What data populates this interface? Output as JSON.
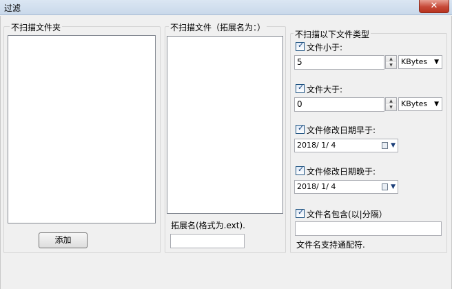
{
  "window": {
    "title": "过滤",
    "close_glyph": "✕"
  },
  "folders_panel": {
    "title": "不扫描文件夹",
    "add_button": "添加"
  },
  "files_panel": {
    "title": "不扫描文件（拓展名为：）",
    "ext_label": "拓展名(格式为.ext).",
    "ext_value": ""
  },
  "types_panel": {
    "title": "不扫描以下文件类型",
    "size_less": {
      "label": "文件小于:",
      "checked": true,
      "value": "5",
      "unit": "KBytes"
    },
    "size_greater": {
      "label": "文件大于:",
      "checked": true,
      "value": "0",
      "unit": "KBytes"
    },
    "modified_before": {
      "label": "文件修改日期早于:",
      "checked": true,
      "date": "2018/  1/  4"
    },
    "modified_after": {
      "label": "文件修改日期晚于:",
      "checked": true,
      "date": "2018/  1/  4"
    },
    "name_contains": {
      "label": "文件名包含(以|分隔）",
      "checked": true,
      "value": ""
    },
    "wildcard_note": "文件名支持通配符."
  },
  "icons": {
    "check": "check-icon",
    "spin_up": "spin-up-icon",
    "spin_down": "spin-down-icon",
    "dropdown": "chevron-down-icon",
    "calendar": "calendar-icon"
  },
  "colors": {
    "title_bar": "#d4e1f0",
    "close_button": "#c74a38",
    "background": "#f0f0f0"
  }
}
